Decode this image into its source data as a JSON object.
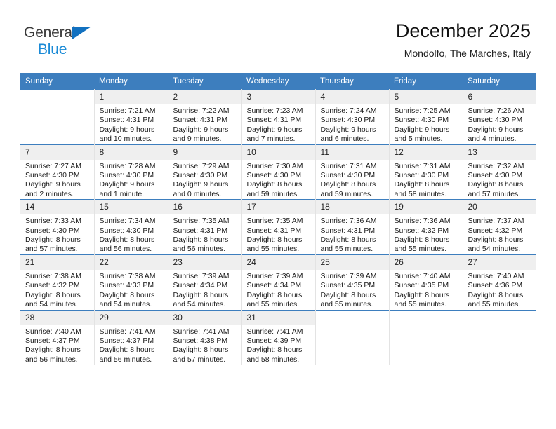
{
  "brand": {
    "name_part1": "General",
    "name_part2": "Blue",
    "triangle_icon": "triangle-icon",
    "colors": {
      "part1": "#3a3a3a",
      "part2": "#1a8ad6",
      "triangle": "#1271c0"
    }
  },
  "header": {
    "title": "December 2025",
    "subtitle": "Mondolfo, The Marches, Italy"
  },
  "theme": {
    "header_blue": "#3d7ebe",
    "daynum_band": "#efefef",
    "cell_border": "#e3e3e3"
  },
  "weekdays": [
    "Sunday",
    "Monday",
    "Tuesday",
    "Wednesday",
    "Thursday",
    "Friday",
    "Saturday"
  ],
  "weeks": [
    [
      {
        "day": "",
        "sunrise": "",
        "sunset": "",
        "daylight1": "",
        "daylight2": ""
      },
      {
        "day": "1",
        "sunrise": "Sunrise: 7:21 AM",
        "sunset": "Sunset: 4:31 PM",
        "daylight1": "Daylight: 9 hours",
        "daylight2": "and 10 minutes."
      },
      {
        "day": "2",
        "sunrise": "Sunrise: 7:22 AM",
        "sunset": "Sunset: 4:31 PM",
        "daylight1": "Daylight: 9 hours",
        "daylight2": "and 9 minutes."
      },
      {
        "day": "3",
        "sunrise": "Sunrise: 7:23 AM",
        "sunset": "Sunset: 4:31 PM",
        "daylight1": "Daylight: 9 hours",
        "daylight2": "and 7 minutes."
      },
      {
        "day": "4",
        "sunrise": "Sunrise: 7:24 AM",
        "sunset": "Sunset: 4:30 PM",
        "daylight1": "Daylight: 9 hours",
        "daylight2": "and 6 minutes."
      },
      {
        "day": "5",
        "sunrise": "Sunrise: 7:25 AM",
        "sunset": "Sunset: 4:30 PM",
        "daylight1": "Daylight: 9 hours",
        "daylight2": "and 5 minutes."
      },
      {
        "day": "6",
        "sunrise": "Sunrise: 7:26 AM",
        "sunset": "Sunset: 4:30 PM",
        "daylight1": "Daylight: 9 hours",
        "daylight2": "and 4 minutes."
      }
    ],
    [
      {
        "day": "7",
        "sunrise": "Sunrise: 7:27 AM",
        "sunset": "Sunset: 4:30 PM",
        "daylight1": "Daylight: 9 hours",
        "daylight2": "and 2 minutes."
      },
      {
        "day": "8",
        "sunrise": "Sunrise: 7:28 AM",
        "sunset": "Sunset: 4:30 PM",
        "daylight1": "Daylight: 9 hours",
        "daylight2": "and 1 minute."
      },
      {
        "day": "9",
        "sunrise": "Sunrise: 7:29 AM",
        "sunset": "Sunset: 4:30 PM",
        "daylight1": "Daylight: 9 hours",
        "daylight2": "and 0 minutes."
      },
      {
        "day": "10",
        "sunrise": "Sunrise: 7:30 AM",
        "sunset": "Sunset: 4:30 PM",
        "daylight1": "Daylight: 8 hours",
        "daylight2": "and 59 minutes."
      },
      {
        "day": "11",
        "sunrise": "Sunrise: 7:31 AM",
        "sunset": "Sunset: 4:30 PM",
        "daylight1": "Daylight: 8 hours",
        "daylight2": "and 59 minutes."
      },
      {
        "day": "12",
        "sunrise": "Sunrise: 7:31 AM",
        "sunset": "Sunset: 4:30 PM",
        "daylight1": "Daylight: 8 hours",
        "daylight2": "and 58 minutes."
      },
      {
        "day": "13",
        "sunrise": "Sunrise: 7:32 AM",
        "sunset": "Sunset: 4:30 PM",
        "daylight1": "Daylight: 8 hours",
        "daylight2": "and 57 minutes."
      }
    ],
    [
      {
        "day": "14",
        "sunrise": "Sunrise: 7:33 AM",
        "sunset": "Sunset: 4:30 PM",
        "daylight1": "Daylight: 8 hours",
        "daylight2": "and 57 minutes."
      },
      {
        "day": "15",
        "sunrise": "Sunrise: 7:34 AM",
        "sunset": "Sunset: 4:30 PM",
        "daylight1": "Daylight: 8 hours",
        "daylight2": "and 56 minutes."
      },
      {
        "day": "16",
        "sunrise": "Sunrise: 7:35 AM",
        "sunset": "Sunset: 4:31 PM",
        "daylight1": "Daylight: 8 hours",
        "daylight2": "and 56 minutes."
      },
      {
        "day": "17",
        "sunrise": "Sunrise: 7:35 AM",
        "sunset": "Sunset: 4:31 PM",
        "daylight1": "Daylight: 8 hours",
        "daylight2": "and 55 minutes."
      },
      {
        "day": "18",
        "sunrise": "Sunrise: 7:36 AM",
        "sunset": "Sunset: 4:31 PM",
        "daylight1": "Daylight: 8 hours",
        "daylight2": "and 55 minutes."
      },
      {
        "day": "19",
        "sunrise": "Sunrise: 7:36 AM",
        "sunset": "Sunset: 4:32 PM",
        "daylight1": "Daylight: 8 hours",
        "daylight2": "and 55 minutes."
      },
      {
        "day": "20",
        "sunrise": "Sunrise: 7:37 AM",
        "sunset": "Sunset: 4:32 PM",
        "daylight1": "Daylight: 8 hours",
        "daylight2": "and 54 minutes."
      }
    ],
    [
      {
        "day": "21",
        "sunrise": "Sunrise: 7:38 AM",
        "sunset": "Sunset: 4:32 PM",
        "daylight1": "Daylight: 8 hours",
        "daylight2": "and 54 minutes."
      },
      {
        "day": "22",
        "sunrise": "Sunrise: 7:38 AM",
        "sunset": "Sunset: 4:33 PM",
        "daylight1": "Daylight: 8 hours",
        "daylight2": "and 54 minutes."
      },
      {
        "day": "23",
        "sunrise": "Sunrise: 7:39 AM",
        "sunset": "Sunset: 4:34 PM",
        "daylight1": "Daylight: 8 hours",
        "daylight2": "and 54 minutes."
      },
      {
        "day": "24",
        "sunrise": "Sunrise: 7:39 AM",
        "sunset": "Sunset: 4:34 PM",
        "daylight1": "Daylight: 8 hours",
        "daylight2": "and 55 minutes."
      },
      {
        "day": "25",
        "sunrise": "Sunrise: 7:39 AM",
        "sunset": "Sunset: 4:35 PM",
        "daylight1": "Daylight: 8 hours",
        "daylight2": "and 55 minutes."
      },
      {
        "day": "26",
        "sunrise": "Sunrise: 7:40 AM",
        "sunset": "Sunset: 4:35 PM",
        "daylight1": "Daylight: 8 hours",
        "daylight2": "and 55 minutes."
      },
      {
        "day": "27",
        "sunrise": "Sunrise: 7:40 AM",
        "sunset": "Sunset: 4:36 PM",
        "daylight1": "Daylight: 8 hours",
        "daylight2": "and 55 minutes."
      }
    ],
    [
      {
        "day": "28",
        "sunrise": "Sunrise: 7:40 AM",
        "sunset": "Sunset: 4:37 PM",
        "daylight1": "Daylight: 8 hours",
        "daylight2": "and 56 minutes."
      },
      {
        "day": "29",
        "sunrise": "Sunrise: 7:41 AM",
        "sunset": "Sunset: 4:37 PM",
        "daylight1": "Daylight: 8 hours",
        "daylight2": "and 56 minutes."
      },
      {
        "day": "30",
        "sunrise": "Sunrise: 7:41 AM",
        "sunset": "Sunset: 4:38 PM",
        "daylight1": "Daylight: 8 hours",
        "daylight2": "and 57 minutes."
      },
      {
        "day": "31",
        "sunrise": "Sunrise: 7:41 AM",
        "sunset": "Sunset: 4:39 PM",
        "daylight1": "Daylight: 8 hours",
        "daylight2": "and 58 minutes."
      },
      {
        "day": "",
        "sunrise": "",
        "sunset": "",
        "daylight1": "",
        "daylight2": ""
      },
      {
        "day": "",
        "sunrise": "",
        "sunset": "",
        "daylight1": "",
        "daylight2": ""
      },
      {
        "day": "",
        "sunrise": "",
        "sunset": "",
        "daylight1": "",
        "daylight2": ""
      }
    ]
  ]
}
